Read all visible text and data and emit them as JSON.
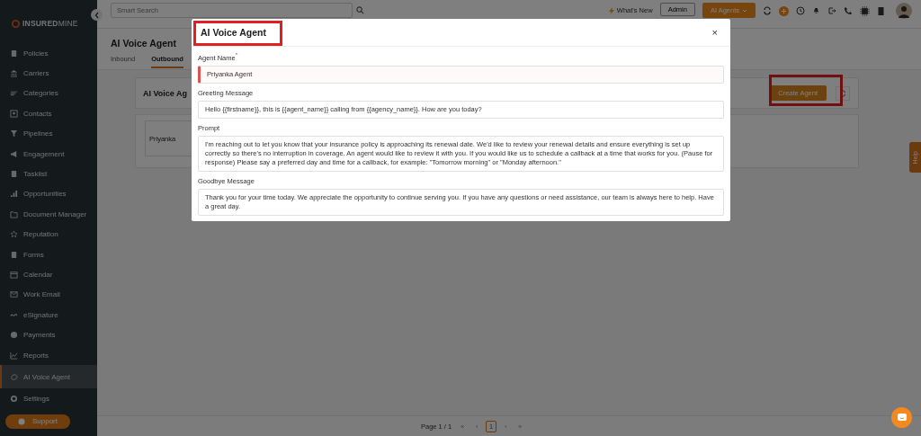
{
  "sidebar": {
    "logo_strong": "INSURED",
    "logo_light": "MINE",
    "items": [
      {
        "label": "Policies",
        "selected": false
      },
      {
        "label": "Carriers",
        "selected": false
      },
      {
        "label": "Categories",
        "selected": false
      },
      {
        "label": "Contacts",
        "selected": false
      },
      {
        "label": "Pipelines",
        "selected": false
      },
      {
        "label": "Engagement",
        "selected": false
      },
      {
        "label": "Tasklist",
        "selected": false
      },
      {
        "label": "Opportunities",
        "selected": false
      },
      {
        "label": "Document Manager",
        "selected": false
      },
      {
        "label": "Reputation",
        "selected": false
      },
      {
        "label": "Forms",
        "selected": false
      },
      {
        "label": "Calendar",
        "selected": false
      },
      {
        "label": "Work Email",
        "selected": false
      },
      {
        "label": "eSignature",
        "selected": false
      },
      {
        "label": "Payments",
        "selected": false
      },
      {
        "label": "Reports",
        "selected": false
      },
      {
        "label": "AI Voice Agent",
        "selected": true
      },
      {
        "label": "Settings",
        "selected": false
      }
    ],
    "support": "Support"
  },
  "topbar": {
    "search_placeholder": "Smart Search",
    "whats_new": "What's New",
    "admin": "Admin",
    "agents": "AI Agents"
  },
  "page": {
    "title": "AI Voice Agent",
    "tabs": [
      {
        "label": "Inbound",
        "selected": false
      },
      {
        "label": "Outbound",
        "selected": true
      }
    ],
    "card_title": "AI Voice Ag",
    "create_button": {
      "label": "Create Agent",
      "highlighted": true
    },
    "agent_card": "Priyanka"
  },
  "pagination": {
    "label": "Page 1 / 1",
    "first": "«",
    "prev": "‹",
    "pages": [
      {
        "label": "1",
        "selected": true
      }
    ],
    "next": "›",
    "last": "»"
  },
  "help_tab": "Help",
  "modal": {
    "title": "AI Voice Agent",
    "title_highlighted": true,
    "close": "×",
    "fields": [
      {
        "label": "Agent Name",
        "required_mark": "*",
        "kind": "input",
        "focused": true,
        "value": "Priyanka Agent"
      },
      {
        "label": "Greeting Message",
        "kind": "input",
        "focused": false,
        "value": "Hello {{firstname}}, this is {{agent_name}} calling from {{agency_name}}. How are you today?"
      },
      {
        "label": "Prompt",
        "kind": "textarea",
        "focused": false,
        "value": "I'm reaching out to let you know that your insurance policy is approaching its renewal date. We'd like to review your renewal details and ensure everything is set up correctly so there's no interruption in coverage. An agent would like to review it with you. If you would like us to schedule a callback at a time that works for you. (Pause for response) Please say a preferred day and time for a callback, for example: \"Tomorrow morning\" or \"Monday afternoon.\""
      },
      {
        "label": "Goodbye Message",
        "kind": "textarea",
        "focused": false,
        "value": "Thank you for your time today. We appreciate the opportunity to continue serving you. If you have any questions or need assistance, our team is always here to help. Have a great day."
      }
    ]
  }
}
